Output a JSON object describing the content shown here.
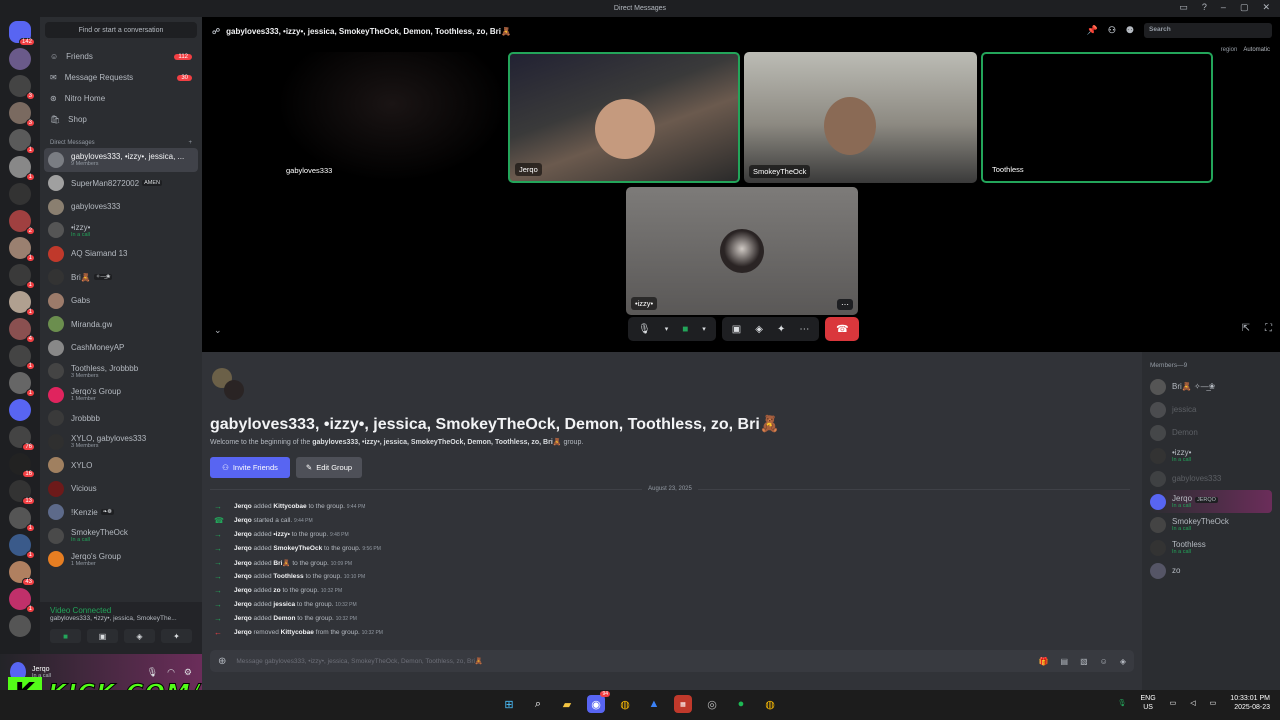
{
  "window": {
    "title": "Direct Messages"
  },
  "sidebar": {
    "find_placeholder": "Find or start a conversation",
    "home_badge": "142",
    "nav": [
      {
        "label": "Friends",
        "badge": "112"
      },
      {
        "label": "Message Requests",
        "badge": "30"
      },
      {
        "label": "Nitro Home",
        "badge": ""
      },
      {
        "label": "Shop",
        "badge": ""
      }
    ],
    "dm_header": "Direct Messages",
    "dms": [
      {
        "name": "gabyloves333, •izzy•, jessica, ...",
        "sub": "9 Members",
        "color": "#7a7d83"
      },
      {
        "name": "SuperMan8272002",
        "sub": "",
        "tag": "AMEN",
        "color": "#a0a0a0"
      },
      {
        "name": "gabyloves333",
        "sub": "",
        "color": "#8a7f70"
      },
      {
        "name": "•izzy•",
        "sub": "In a call",
        "color": "#555"
      },
      {
        "name": "AQ Siamand 13",
        "sub": "",
        "color": "#c0392b"
      },
      {
        "name": "Bri🧸",
        "sub": "",
        "tag": "✧—̲❀",
        "color": "#333"
      },
      {
        "name": "Gabs",
        "sub": "",
        "color": "#9c7b6a"
      },
      {
        "name": "Miranda.gw",
        "sub": "",
        "color": "#6b8e4e"
      },
      {
        "name": "CashMoneyAP",
        "sub": "",
        "color": "#888"
      },
      {
        "name": "Toothless, Jrobbbb",
        "sub": "3 Members",
        "color": "#444"
      },
      {
        "name": "Jerqo's Group",
        "sub": "1 Member",
        "color": "#e0245e"
      },
      {
        "name": "Jrobbbb",
        "sub": "",
        "color": "#3a3a3a"
      },
      {
        "name": "XYLO, gabyloves333",
        "sub": "3 Members",
        "color": "#2f2f2f"
      },
      {
        "name": "XYLO",
        "sub": "",
        "color": "#a08060"
      },
      {
        "name": "Vicious",
        "sub": "",
        "color": "#6d1a1a"
      },
      {
        "name": "!Kenzie",
        "sub": "",
        "tag": "❧❁",
        "color": "#5d6a8a"
      },
      {
        "name": "SmokeyTheOck",
        "sub": "In a call",
        "color": "#4a4a4a"
      },
      {
        "name": "Jerqo's Group",
        "sub": "1 Member",
        "color": "#e67e22"
      }
    ],
    "voice": {
      "status": "Video Connected",
      "channel": "gabyloves333, •izzy•, jessica, SmokeyThe..."
    },
    "user": {
      "name": "Jerqo",
      "status": "In a call"
    }
  },
  "kick": {
    "letter": "K",
    "text": "KICK.COM/JERQO"
  },
  "call": {
    "title": "gabyloves333, •izzy•, jessica, SmokeyTheOck, Demon, Toothless, zo, Bri🧸",
    "search_placeholder": "Search",
    "region_label": "region",
    "region_value": "Automatic",
    "tiles": [
      {
        "name": "gabyloves333"
      },
      {
        "name": "Jerqo"
      },
      {
        "name": "SmokeyTheOck"
      },
      {
        "name": "Toothless"
      },
      {
        "name": "•izzy•"
      }
    ]
  },
  "chat": {
    "heading": "gabyloves333, •izzy•, jessica, SmokeyTheOck, Demon, Toothless, zo, Bri🧸",
    "welcome_pre": "Welcome to the beginning of the",
    "welcome_name": "gabyloves333, •izzy•, jessica, SmokeyTheOck, Demon, Toothless, zo, Bri🧸",
    "welcome_post": "group.",
    "invite_label": "Invite Friends",
    "edit_label": "Edit Group",
    "date": "August 23, 2025",
    "messages": [
      {
        "type": "add",
        "actor": "Jerqo",
        "verb": "added",
        "target": "Kittycobae",
        "tail": "to the group.",
        "time": "9:44 PM"
      },
      {
        "type": "call",
        "actor": "Jerqo",
        "verb": "started a call.",
        "target": "",
        "tail": "",
        "time": "9:44 PM"
      },
      {
        "type": "add",
        "actor": "Jerqo",
        "verb": "added",
        "target": "•izzy•",
        "tail": "to the group.",
        "time": "9:48 PM"
      },
      {
        "type": "add",
        "actor": "Jerqo",
        "verb": "added",
        "target": "SmokeyTheOck",
        "tail": "to the group.",
        "time": "9:56 PM"
      },
      {
        "type": "add",
        "actor": "Jerqo",
        "verb": "added",
        "target": "Bri🧸",
        "tail": "to the group.",
        "time": "10:09 PM"
      },
      {
        "type": "add",
        "actor": "Jerqo",
        "verb": "added",
        "target": "Toothless",
        "tail": "to the group.",
        "time": "10:10 PM"
      },
      {
        "type": "add",
        "actor": "Jerqo",
        "verb": "added",
        "target": "zo",
        "tail": "to the group.",
        "time": "10:32 PM"
      },
      {
        "type": "add",
        "actor": "Jerqo",
        "verb": "added",
        "target": "jessica",
        "tail": "to the group.",
        "time": "10:32 PM"
      },
      {
        "type": "add",
        "actor": "Jerqo",
        "verb": "added",
        "target": "Demon",
        "tail": "to the group.",
        "time": "10:32 PM"
      },
      {
        "type": "remove",
        "actor": "Jerqo",
        "verb": "removed",
        "target": "Kittycobae",
        "tail": "from the group.",
        "time": "10:32 PM"
      }
    ],
    "composer_placeholder": "Message gabyloves333, •izzy•, jessica, SmokeyTheOck, Demon, Toothless, zo, Bri🧸"
  },
  "members": {
    "header": "Members—9",
    "list": [
      {
        "name": "Bri🧸 ✧—̲❀",
        "sub": "",
        "offline": false
      },
      {
        "name": "jessica",
        "sub": "",
        "offline": true
      },
      {
        "name": "Demon",
        "sub": "",
        "offline": true
      },
      {
        "name": "•izzy•",
        "sub": "In a call",
        "offline": false
      },
      {
        "name": "gabyloves333",
        "sub": "",
        "offline": true
      },
      {
        "name": "Jerqo",
        "sub": "In a call",
        "tag": "JERQO",
        "offline": false
      },
      {
        "name": "SmokeyTheOck",
        "sub": "In a call",
        "offline": false
      },
      {
        "name": "Toothless",
        "sub": "In a call",
        "offline": false
      },
      {
        "name": "zo",
        "sub": "",
        "offline": false
      }
    ]
  },
  "taskbar": {
    "lang": "ENG",
    "region": "US",
    "time": "10:33:01 PM",
    "date": "2025-08-23",
    "discord_badge": "94"
  }
}
